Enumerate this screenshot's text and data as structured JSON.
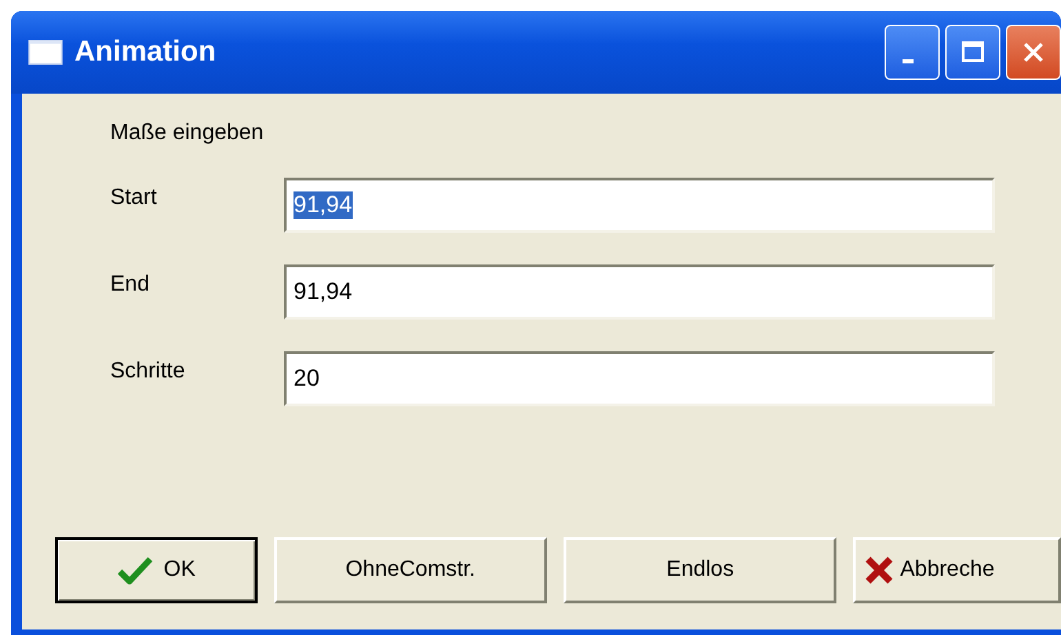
{
  "window": {
    "title": "Animation"
  },
  "heading": "Maße eingeben",
  "fields": [
    {
      "label": "Start",
      "value": "91,94",
      "selected": true
    },
    {
      "label": "End",
      "value": "91,94",
      "selected": false
    },
    {
      "label": "Schritte",
      "value": "20",
      "selected": false
    }
  ],
  "buttons": [
    {
      "label": "OK",
      "kind": "ok",
      "default": true
    },
    {
      "label": "OhneComstr.",
      "kind": "plain",
      "default": false
    },
    {
      "label": "Endlos",
      "kind": "plain",
      "default": false
    },
    {
      "label": "Abbreche",
      "kind": "cancel",
      "default": false
    }
  ]
}
